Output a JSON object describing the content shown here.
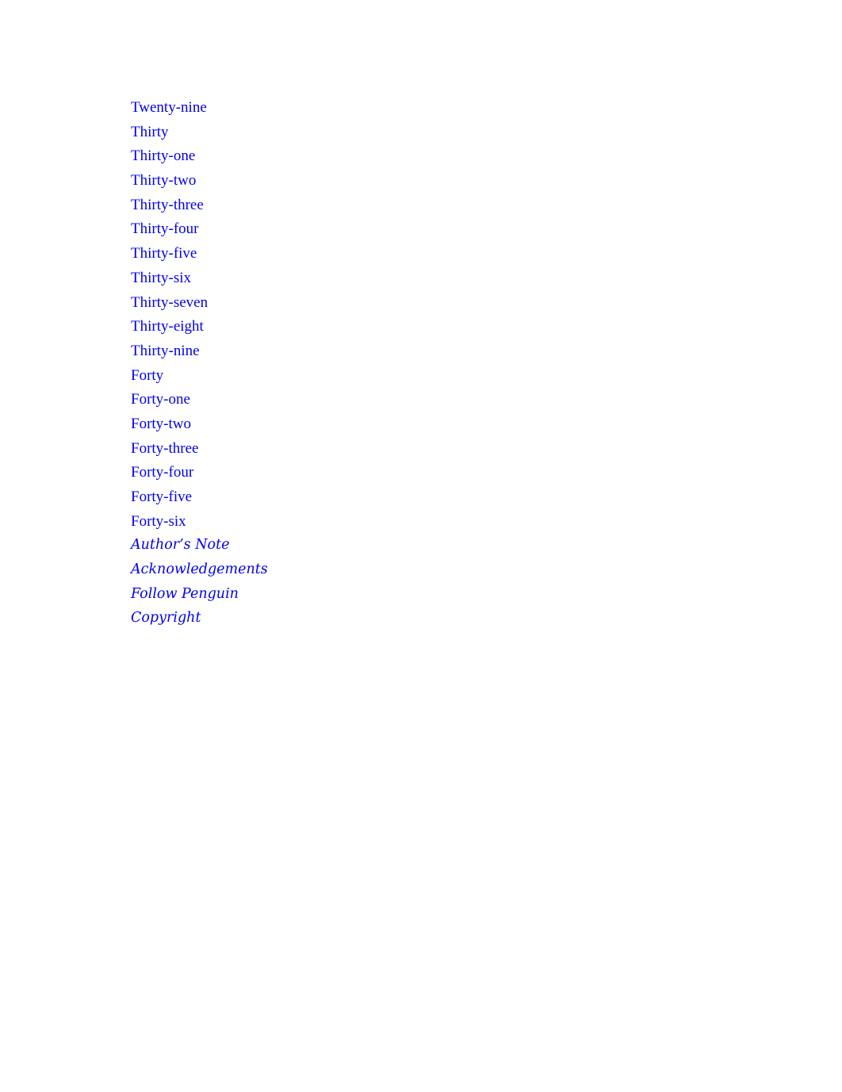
{
  "toc": {
    "items": [
      {
        "label": "Twenty-nine",
        "italic": false
      },
      {
        "label": "Thirty",
        "italic": false
      },
      {
        "label": "Thirty-one",
        "italic": false
      },
      {
        "label": "Thirty-two",
        "italic": false
      },
      {
        "label": "Thirty-three",
        "italic": false
      },
      {
        "label": "Thirty-four",
        "italic": false
      },
      {
        "label": "Thirty-five",
        "italic": false
      },
      {
        "label": "Thirty-six",
        "italic": false
      },
      {
        "label": "Thirty-seven",
        "italic": false
      },
      {
        "label": "Thirty-eight",
        "italic": false
      },
      {
        "label": "Thirty-nine",
        "italic": false
      },
      {
        "label": "Forty",
        "italic": false
      },
      {
        "label": "Forty-one",
        "italic": false
      },
      {
        "label": "Forty-two",
        "italic": false
      },
      {
        "label": "Forty-three",
        "italic": false
      },
      {
        "label": "Forty-four",
        "italic": false
      },
      {
        "label": "Forty-five",
        "italic": false
      },
      {
        "label": "Forty-six",
        "italic": false
      },
      {
        "label": "Author’s Note",
        "italic": true
      },
      {
        "label": "Acknowledgements",
        "italic": true
      },
      {
        "label": "Follow Penguin",
        "italic": true
      },
      {
        "label": "Copyright",
        "italic": true
      }
    ],
    "link_color": "#0000ee"
  }
}
